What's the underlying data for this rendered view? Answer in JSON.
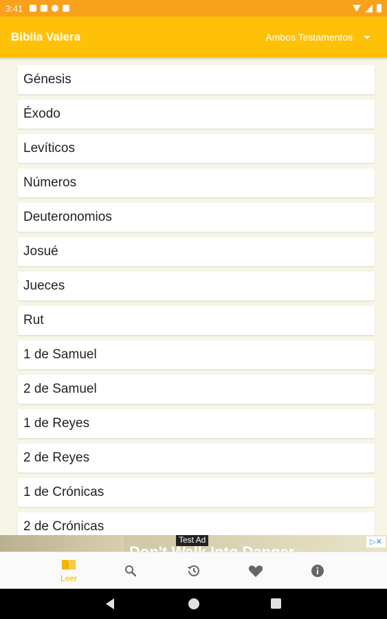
{
  "status_bar": {
    "time": "3:41",
    "icons": [
      "notification-icon",
      "notification-icon",
      "app-icon",
      "sd-card-icon",
      "wifi-icon",
      "signal-icon",
      "battery-icon"
    ]
  },
  "app_bar": {
    "title": "Biblia Valera",
    "testament_selected": "Ambos Testamentos",
    "colors": {
      "bar": "#ffc107",
      "status": "#f9a11b",
      "accent": "#f4b400"
    }
  },
  "books": [
    "Génesis",
    "Éxodo",
    "Levíticos",
    "Números",
    "Deuteronomios",
    "Josué",
    "Jueces",
    "Rut",
    "1 de Samuel",
    "2 de Samuel",
    "1 de Reyes",
    "2 de Reyes",
    "1 de Crónicas",
    "2 de Crónicas"
  ],
  "ad": {
    "badge": "Test Ad",
    "text": "Don't Walk Into Danger",
    "close_label": "▷✕"
  },
  "bottom_nav": {
    "items": [
      {
        "label": "Leer",
        "icon": "book-open-icon",
        "active": true
      },
      {
        "label": "",
        "icon": "search-icon"
      },
      {
        "label": "",
        "icon": "history-icon"
      },
      {
        "label": "",
        "icon": "heart-icon"
      },
      {
        "label": "",
        "icon": "info-icon"
      }
    ]
  }
}
